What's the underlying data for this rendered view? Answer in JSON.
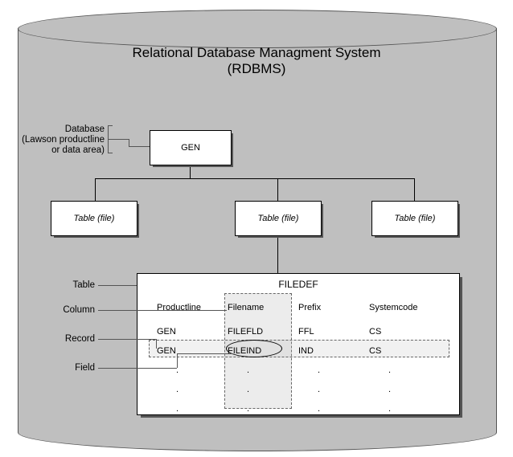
{
  "title_line1": "Relational Database Managment System",
  "title_line2": "(RDBMS)",
  "labels": {
    "database": "Database",
    "database_sub1": "(Lawson productline",
    "database_sub2": "or data area)",
    "table": "Table",
    "column": "Column",
    "record": "Record",
    "field": "Field"
  },
  "root_box": "GEN",
  "child_boxes": [
    "Table (file)",
    "Table (file)",
    "Table (file)"
  ],
  "filedef": {
    "title": "FILEDEF",
    "columns": [
      "Productline",
      "Filename",
      "Prefix",
      "Systemcode"
    ],
    "rows": [
      [
        "GEN",
        "FILEFLD",
        "FFL",
        "CS"
      ],
      [
        "GEN",
        "FILEIND",
        "IND",
        "CS"
      ]
    ]
  },
  "dots": [
    ".",
    ".",
    ".",
    "."
  ]
}
